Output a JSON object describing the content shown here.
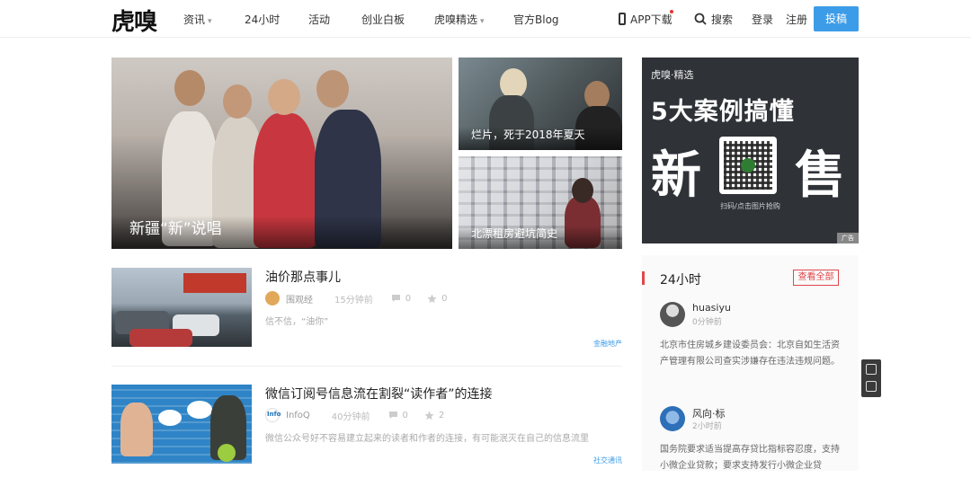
{
  "header": {
    "logo": "虎嗅",
    "nav": [
      {
        "label": "资讯",
        "dropdown": true
      },
      {
        "label": "24小时",
        "dropdown": false
      },
      {
        "label": "活动",
        "dropdown": false
      },
      {
        "label": "创业白板",
        "dropdown": false
      },
      {
        "label": "虎嗅精选",
        "dropdown": true
      },
      {
        "label": "官方Blog",
        "dropdown": false
      }
    ],
    "app_download": "APP下载",
    "search": "搜索",
    "login": "登录",
    "register": "注册",
    "submit": "投稿"
  },
  "hero": {
    "main": {
      "caption": "新疆“新”说唱"
    },
    "side": [
      {
        "caption": "烂片，死于2018年夏天"
      },
      {
        "caption": "北漂租房避坑简史"
      }
    ]
  },
  "ad": {
    "brand": "虎嗅·精选",
    "line1": "5大案例搞懂",
    "line2a": "新",
    "line2b": "售",
    "scan_hint": "扫码/点击图片抢购",
    "tag": "广告"
  },
  "feed": [
    {
      "title": "油价那点事儿",
      "author": "围观经",
      "time": "15分钟前",
      "comments": "0",
      "likes": "0",
      "summary": "信不信，“油你”",
      "tag": "金融地产"
    },
    {
      "title": "微信订阅号信息流在割裂“读作者”的连接",
      "author": "InfoQ",
      "time": "40分钟前",
      "comments": "0",
      "likes": "2",
      "summary": "微信公众号好不容易建立起来的读者和作者的连接，有可能泯灭在自己的信息流里",
      "tag": "社交通讯"
    }
  ],
  "side24": {
    "heading": "24小时",
    "view_all": "查看全部",
    "items": [
      {
        "name": "huasiyu",
        "time": "0分钟前",
        "text": "北京市住房城乡建设委员会：北京自如生活资产管理有限公司查实涉嫌存在违法违规问题。"
      },
      {
        "name": "风向·标",
        "time": "2小时前",
        "text": "国务院要求适当提高存贷比指标容忍度，支持小微企业贷款；要求支持发行小微企业贷"
      }
    ]
  }
}
